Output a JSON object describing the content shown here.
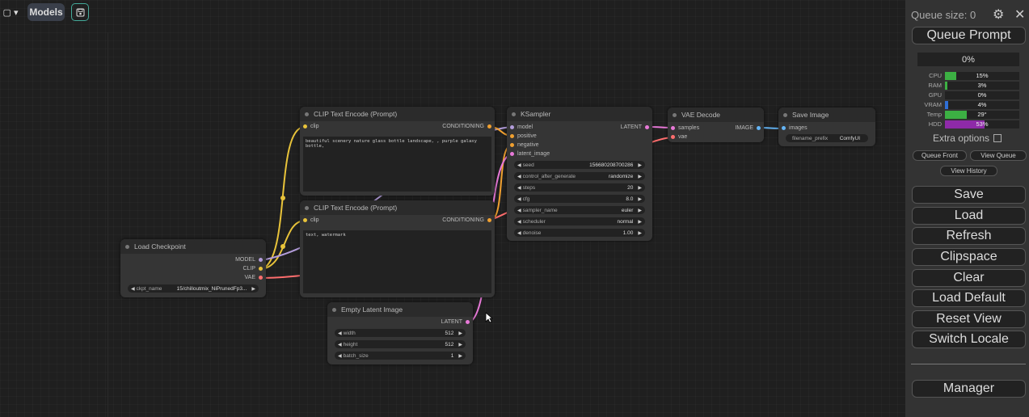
{
  "topbar": {
    "folder_label": "▢ ▾",
    "models_label": "Models",
    "save_icon": "💾"
  },
  "nodes": {
    "clip_pos": {
      "title": "CLIP Text Encode (Prompt)",
      "input": "clip",
      "output": "CONDITIONING",
      "text": "beautiful scenery nature glass bottle landscape, , purple galaxy bottle,"
    },
    "clip_neg": {
      "title": "CLIP Text Encode (Prompt)",
      "input": "clip",
      "output": "CONDITIONING",
      "text": "text, watermark"
    },
    "checkpoint": {
      "title": "Load Checkpoint",
      "outputs": [
        "MODEL",
        "CLIP",
        "VAE"
      ],
      "widget_label": "ckpt_name",
      "widget_value": "15/chilloutmix_NiPrunedFp3..."
    },
    "latent": {
      "title": "Empty Latent Image",
      "output": "LATENT",
      "widgets": [
        {
          "label": "width",
          "value": "512"
        },
        {
          "label": "height",
          "value": "512"
        },
        {
          "label": "batch_size",
          "value": "1"
        }
      ]
    },
    "ksampler": {
      "title": "KSampler",
      "inputs": [
        "model",
        "positive",
        "negative",
        "latent_image"
      ],
      "output": "LATENT",
      "widgets": [
        {
          "label": "seed",
          "value": "156680208700286"
        },
        {
          "label": "control_after_generate",
          "value": "randomize"
        },
        {
          "label": "steps",
          "value": "20"
        },
        {
          "label": "cfg",
          "value": "8.0"
        },
        {
          "label": "sampler_name",
          "value": "euler"
        },
        {
          "label": "scheduler",
          "value": "normal"
        },
        {
          "label": "denoise",
          "value": "1.00"
        }
      ]
    },
    "vae_decode": {
      "title": "VAE Decode",
      "inputs": [
        "samples",
        "vae"
      ],
      "output": "IMAGE"
    },
    "save_image": {
      "title": "Save Image",
      "input": "images",
      "widget_label": "filename_prefix",
      "widget_value": "ComfyUI"
    }
  },
  "panel": {
    "queue_size": "Queue size: 0",
    "queue_prompt": "Queue Prompt",
    "progress": "0%",
    "monitors": [
      {
        "label": "CPU",
        "value": "15%",
        "level": 0.15,
        "color": "#3cb043"
      },
      {
        "label": "RAM",
        "value": "3%",
        "level": 0.03,
        "color": "#3cb043"
      },
      {
        "label": "GPU",
        "value": "0%",
        "level": 0.0,
        "color": "#3cb043"
      },
      {
        "label": "VRAM",
        "value": "4%",
        "level": 0.04,
        "color": "#2f6fd6"
      },
      {
        "label": "Temp",
        "value": "29°",
        "level": 0.29,
        "color": "#3cb043"
      },
      {
        "label": "HDD",
        "value": "53%",
        "level": 0.53,
        "color": "#8e2aa8"
      }
    ],
    "extra_options": "Extra options",
    "queue_front": "Queue Front",
    "view_queue": "View Queue",
    "view_history": "View History",
    "buttons": [
      "Save",
      "Load",
      "Refresh",
      "Clipspace",
      "Clear",
      "Load Default",
      "Reset View",
      "Switch Locale"
    ],
    "manager": "Manager"
  },
  "colors": {
    "clip_wire": "#e8c33a",
    "model_wire": "#b39ddb",
    "conditioning_wire": "#f0a030",
    "latent_wire": "#e879d8",
    "vae_wire": "#ff6e6e",
    "image_wire": "#64b5f6"
  }
}
